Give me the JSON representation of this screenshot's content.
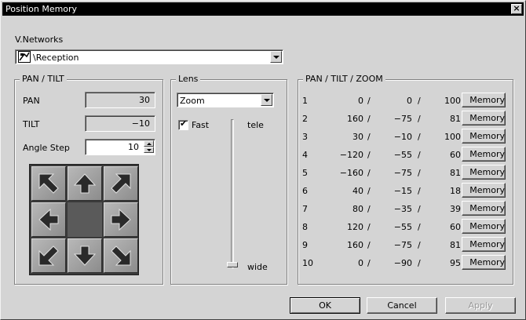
{
  "window": {
    "title": "Position Memory",
    "close_label": "×"
  },
  "network": {
    "label": "V.Networks",
    "selected": "\\Reception",
    "icon": "camera-network-icon"
  },
  "pantilt": {
    "title": "PAN / TILT",
    "pan_label": "PAN",
    "pan_value": "30",
    "tilt_label": "TILT",
    "tilt_value": "−10",
    "angle_label": "Angle Step",
    "angle_value": "10"
  },
  "lens": {
    "title": "Lens",
    "mode": "Zoom",
    "fast_label": "Fast",
    "fast_checked": true,
    "tele_label": "tele",
    "wide_label": "wide"
  },
  "ptz": {
    "title": "PAN / TILT / ZOOM",
    "separator": "/",
    "memory_label": "Memory",
    "rows": [
      {
        "n": "1",
        "pan": "0",
        "tilt": "0",
        "zoom": "100"
      },
      {
        "n": "2",
        "pan": "160",
        "tilt": "−75",
        "zoom": "81"
      },
      {
        "n": "3",
        "pan": "30",
        "tilt": "−10",
        "zoom": "100"
      },
      {
        "n": "4",
        "pan": "−120",
        "tilt": "−55",
        "zoom": "60"
      },
      {
        "n": "5",
        "pan": "−160",
        "tilt": "−75",
        "zoom": "81"
      },
      {
        "n": "6",
        "pan": "40",
        "tilt": "−15",
        "zoom": "18"
      },
      {
        "n": "7",
        "pan": "80",
        "tilt": "−35",
        "zoom": "39"
      },
      {
        "n": "8",
        "pan": "120",
        "tilt": "−55",
        "zoom": "60"
      },
      {
        "n": "9",
        "pan": "160",
        "tilt": "−75",
        "zoom": "81"
      },
      {
        "n": "10",
        "pan": "0",
        "tilt": "−90",
        "zoom": "95"
      }
    ]
  },
  "buttons": {
    "ok": "OK",
    "cancel": "Cancel",
    "apply": "Apply"
  }
}
